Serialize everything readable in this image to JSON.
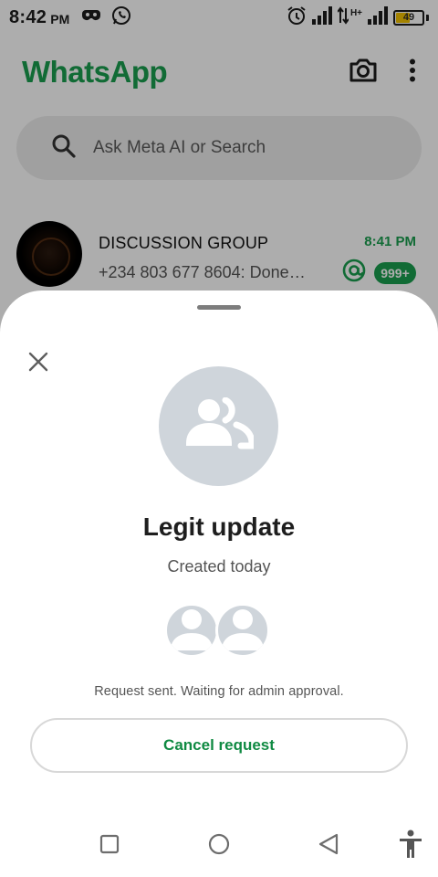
{
  "status_bar": {
    "time": "8:42",
    "ampm": "PM",
    "battery_level": "49",
    "battery_fraction": 0.49,
    "network_label": "H+",
    "left_icons": [
      "game-controller-icon",
      "whatsapp-icon"
    ],
    "right_icons": [
      "alarm-icon",
      "signal-icon",
      "data-arrows-icon",
      "signal-icon-2",
      "battery-icon"
    ]
  },
  "header": {
    "title": "WhatsApp",
    "camera_icon": "camera-icon",
    "menu_icon": "more-vertical-icon"
  },
  "search": {
    "placeholder": "Ask Meta AI or Search"
  },
  "chat": {
    "name": "DISCUSSION GROUP",
    "preview": "+234 803 677 8604: Done…",
    "time": "8:41 PM",
    "unread": "999+",
    "mention_icon": "at-mention-icon"
  },
  "sheet": {
    "group_name": "Legit update",
    "created": "Created today",
    "status_message": "Request sent. Waiting for admin approval.",
    "cancel_label": "Cancel request"
  },
  "colors": {
    "brand_green": "#1a9e4e",
    "button_text_green": "#0f8a42",
    "avatar_placeholder": "#cfd5db"
  },
  "nav": {
    "icons": [
      "recent-apps-icon",
      "home-icon",
      "back-icon",
      "accessibility-icon"
    ]
  }
}
